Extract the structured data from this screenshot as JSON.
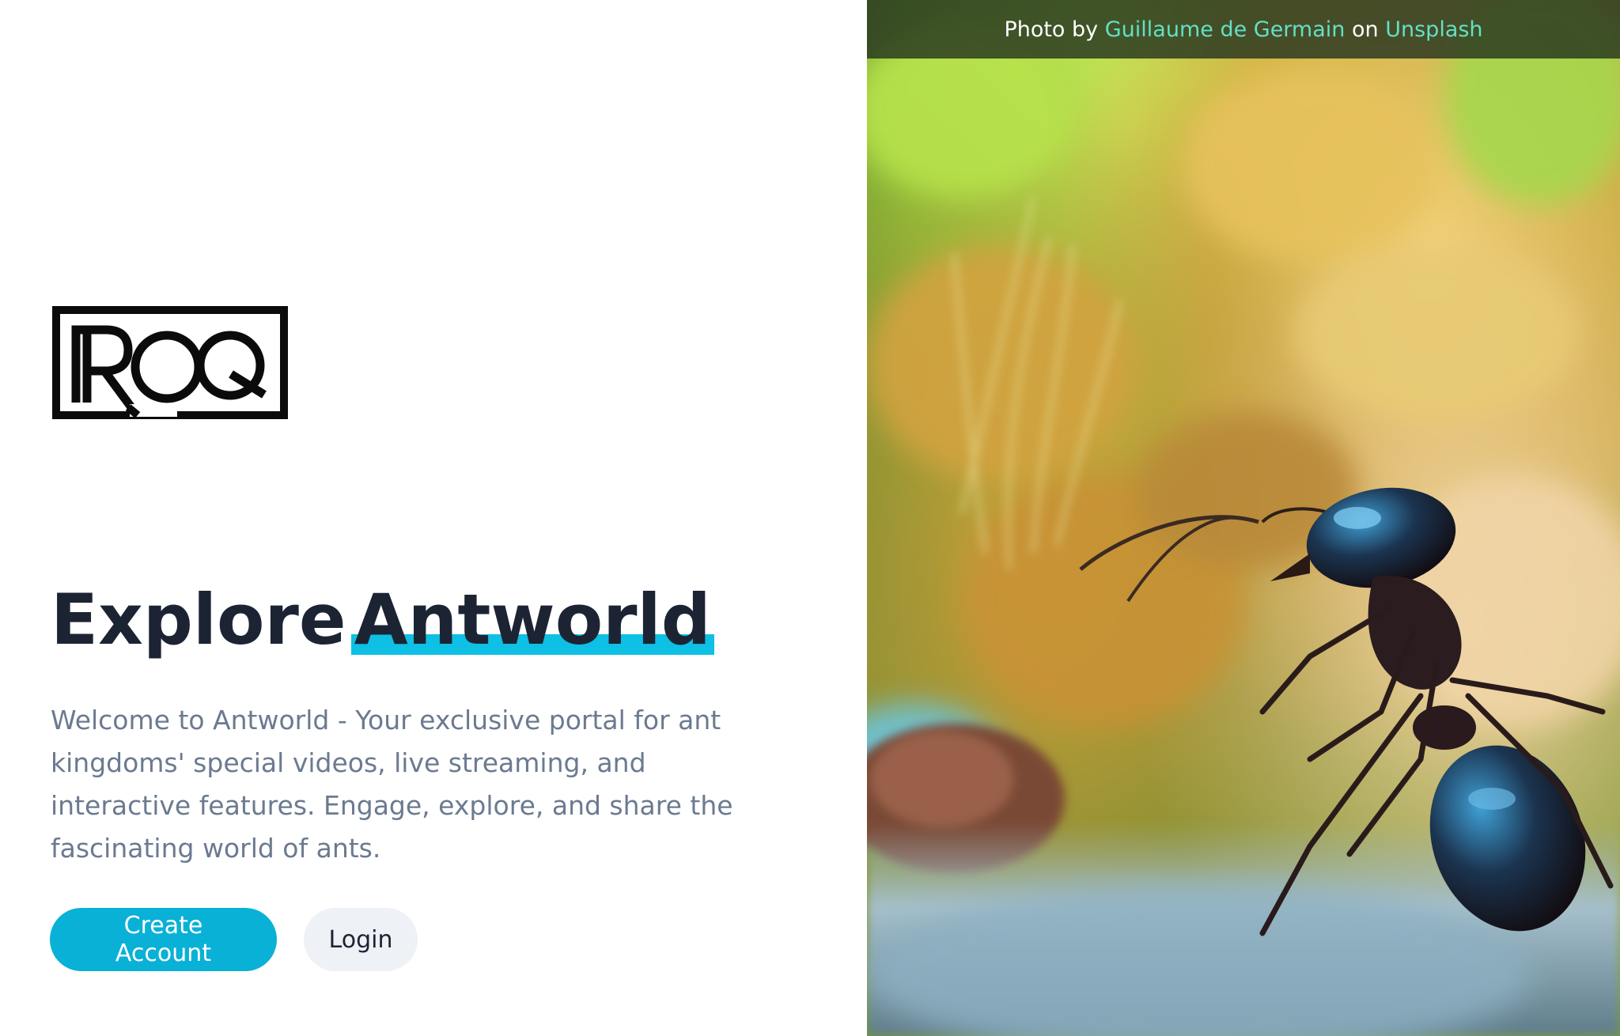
{
  "brand": {
    "logo_text": "ROQ"
  },
  "hero": {
    "headline_prefix": "Explore",
    "headline_highlight": "Antworld",
    "description": "Welcome to Antworld - Your exclusive portal for ant kingdoms' special videos, live streaming, and interactive features. Engage, explore, and share the fascinating world of ants."
  },
  "actions": {
    "create_account_label": "Create Account",
    "login_label": "Login"
  },
  "photo_credit": {
    "prefix": "Photo by",
    "author": "Guillaume de Germain",
    "middle": "on",
    "source": "Unsplash"
  },
  "colors": {
    "accent": "#0ab1d6",
    "highlight": "#0ec0e4",
    "heading": "#1c2434",
    "body_text": "#6b7a90",
    "credit_link": "#62e0c6"
  }
}
